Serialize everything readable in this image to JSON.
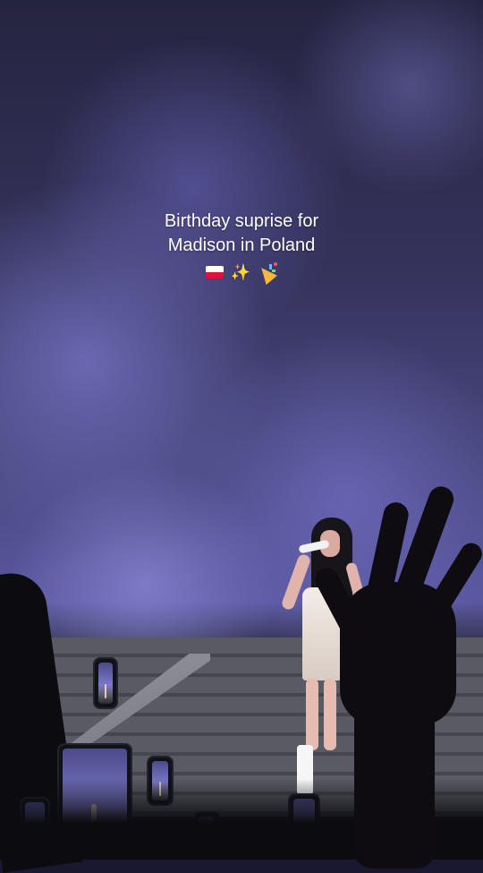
{
  "caption": {
    "line1": "Birthday suprise for",
    "line2": "Madison in Poland",
    "emojis": [
      "flag-poland-icon",
      "sparkles-icon",
      "party-popper-icon"
    ]
  },
  "photo": {
    "subject": "concert performer on stage",
    "colors": {
      "smoke": "#5a58a0",
      "stage": "#5a5a64",
      "crowd": "#0b0b10",
      "dress": "#f4ece6"
    }
  }
}
